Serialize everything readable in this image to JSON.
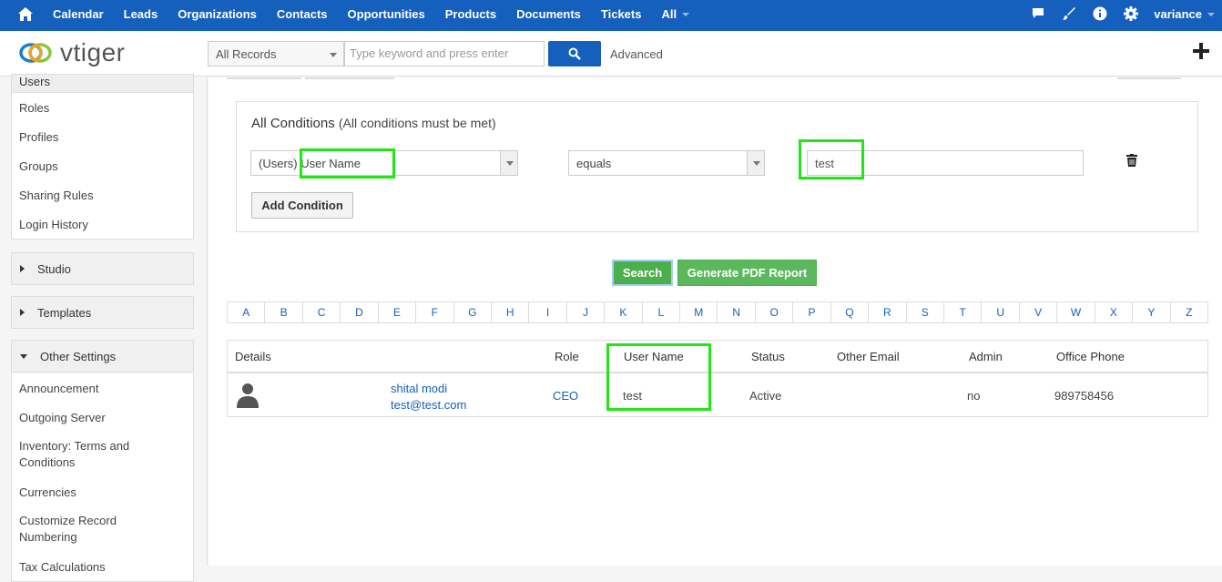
{
  "topnav": {
    "menu": [
      "Calendar",
      "Leads",
      "Organizations",
      "Contacts",
      "Opportunities",
      "Products",
      "Documents",
      "Tickets"
    ],
    "all_label": "All",
    "user": "variance"
  },
  "header": {
    "logo_text": "vtiger",
    "records_select": "All Records",
    "search_placeholder": "Type keyword and press enter",
    "advanced_label": "Advanced"
  },
  "sidebar": {
    "users_label": "Users",
    "user_items": [
      "Roles",
      "Profiles",
      "Groups",
      "Sharing Rules",
      "Login History"
    ],
    "studio_label": "Studio",
    "templates_label": "Templates",
    "other_settings_label": "Other Settings",
    "other_items": [
      "Announcement",
      "Outgoing Server",
      "Inventory: Terms and Conditions",
      "Currencies",
      "Customize Record Numbering",
      "Tax Calculations"
    ]
  },
  "conditions": {
    "title": "All Conditions",
    "note": "(All conditions must be met)",
    "field_select": "(Users) User Name",
    "operator_select": "equals",
    "value": "test",
    "add_condition_label": "Add Condition"
  },
  "actions": {
    "search_label": "Search",
    "pdf_label": "Generate PDF Report"
  },
  "alphabet": [
    "A",
    "B",
    "C",
    "D",
    "E",
    "F",
    "G",
    "H",
    "I",
    "J",
    "K",
    "L",
    "M",
    "N",
    "O",
    "P",
    "Q",
    "R",
    "S",
    "T",
    "U",
    "V",
    "W",
    "X",
    "Y",
    "Z"
  ],
  "table": {
    "headers": {
      "details": "Details",
      "role": "Role",
      "username": "User Name",
      "status": "Status",
      "other_email": "Other Email",
      "admin": "Admin",
      "office_phone": "Office Phone"
    },
    "row": {
      "name": "shital modi",
      "email": "test@test.com",
      "role": "CEO",
      "username": "test",
      "status": "Active",
      "admin": "no",
      "office_phone": "989758456"
    }
  },
  "colors": {
    "brand_blue": "#1560bd",
    "highlight_green": "#22e616",
    "button_green": "#5cb85c"
  }
}
